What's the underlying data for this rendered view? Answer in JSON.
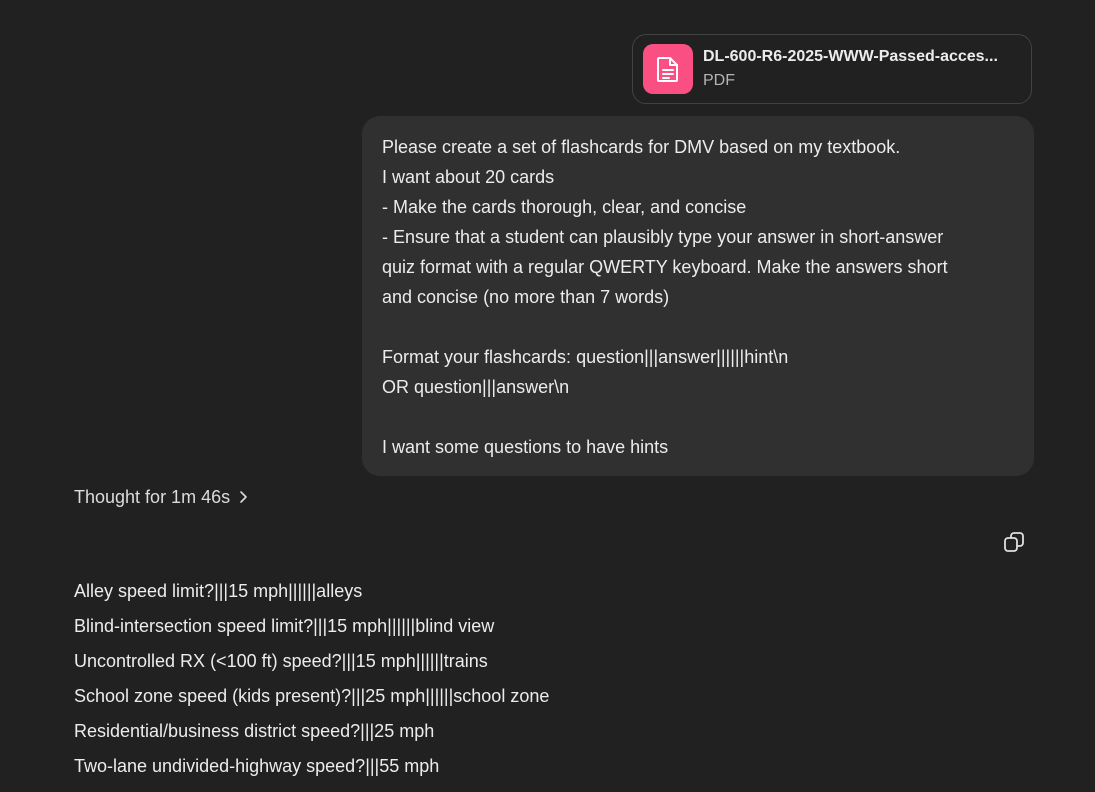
{
  "attachment": {
    "file_name": "DL-600-R6-2025-WWW-Passed-acces...",
    "file_type": "PDF",
    "icon": "document-icon",
    "icon_bg": "#fa4f82"
  },
  "user_message": {
    "lines": [
      "Please create a set of flashcards for DMV based on my textbook.",
      "I want about 20 cards",
      "- Make the cards thorough, clear, and concise",
      "- Ensure that a student can plausibly type your answer in short-answer",
      "quiz format with a regular QWERTY keyboard. Make the answers short",
      "and concise (no more than 7 words)",
      "",
      "Format your flashcards: question|||answer||||||hint\\n",
      "OR question|||answer\\n",
      "",
      "I want some questions to have hints"
    ]
  },
  "thought": {
    "label": "Thought for 1m 46s",
    "icon": "chevron-right-icon"
  },
  "copy": {
    "icon": "copy-icon"
  },
  "flashcards": [
    "Alley speed limit?|||15 mph||||||alleys",
    "Blind-intersection speed limit?|||15 mph||||||blind view",
    "Uncontrolled RX (<100 ft) speed?|||15 mph||||||trains",
    "School zone speed (kids present)?|||25 mph||||||school zone",
    "Residential/business district speed?|||25 mph",
    "Two-lane undivided-highway speed?|||55 mph"
  ]
}
